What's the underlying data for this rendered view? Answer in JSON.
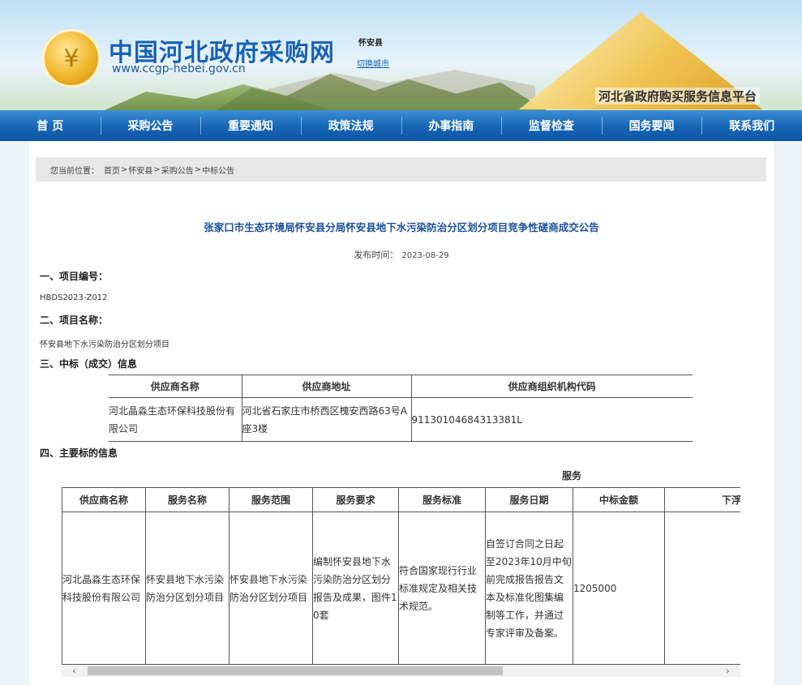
{
  "header": {
    "site_title": "中国河北政府采购网",
    "site_url": "www.ccgp-hebei.gov.cn",
    "city_name": "怀安县",
    "city_switch": "切换城市",
    "platform": "河北省政府购买服务信息平台"
  },
  "nav": [
    "首 页",
    "采购公告",
    "重要通知",
    "政策法规",
    "办事指南",
    "监督检查",
    "国务要闻",
    "联系我们"
  ],
  "breadcrumb": {
    "label": "您当前位置：",
    "items": [
      "首页",
      "怀安县",
      "采购公告",
      "中标公告"
    ],
    "sep": ">"
  },
  "doc": {
    "title": "张家口市生态环境局怀安县分局怀安县地下水污染防治分区划分项目竞争性磋商成交公告",
    "pub_label": "发布时间：",
    "pub_date": "2023-08-29",
    "s1_title": "一、项目编号：",
    "s1_value": "HBDS2023-Z012",
    "s2_title": "二、项目名称：",
    "s2_value": "怀安县地下水污染防治分区划分项目",
    "s3_title": "三、中标（成交）信息",
    "s4_title": "四、主要标的信息"
  },
  "winner_table": {
    "headers": [
      "供应商名称",
      "供应商地址",
      "供应商组织机构代码"
    ],
    "row": [
      "河北晶淼生态环保科技股份有限公司",
      "河北省石家庄市桥西区槐安西路63号A座3楼",
      "91130104684313381L"
    ]
  },
  "service_table": {
    "group_label": "服务",
    "headers": [
      "供应商名称",
      "服务名称",
      "服务范围",
      "服务要求",
      "服务标准",
      "服务日期",
      "中标金额",
      "下浮率"
    ],
    "row": [
      "河北晶淼生态环保科技股份有限公司",
      "怀安县地下水污染防治分区划分项目",
      "怀安县地下水污染防治分区划分项目",
      "编制怀安县地下水污染防治分区划分报告及成果，图件10套",
      "符合国家现行行业标准规定及相关技术规范。",
      "自签订合同之日起至2023年10月中旬前完成报告报告文本及标准化图集编制等工作，并通过专家评审及备案。",
      "1205000",
      ""
    ]
  },
  "icons": {
    "scroll_left": "‹",
    "scroll_right": "›",
    "logo": "¥"
  }
}
